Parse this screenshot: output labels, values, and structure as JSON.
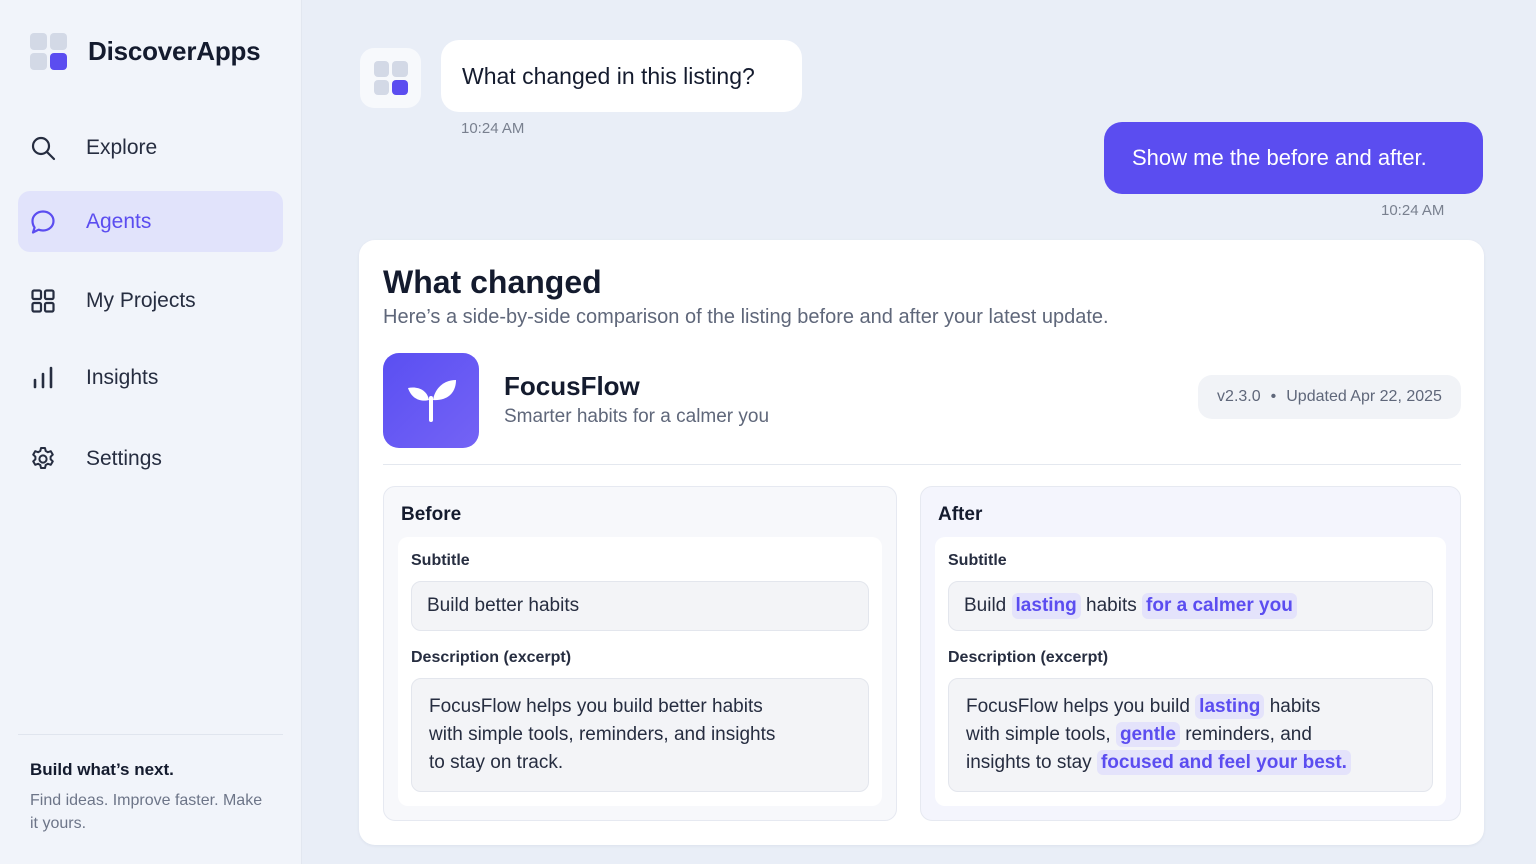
{
  "brand": {
    "name": "DiscoverApps"
  },
  "nav": {
    "items": [
      {
        "label": "Explore",
        "icon": "search-icon"
      },
      {
        "label": "Agents",
        "icon": "chat-bubble-icon",
        "active": true
      },
      {
        "label": "My Projects",
        "icon": "grid-icon"
      },
      {
        "label": "Insights",
        "icon": "bar-chart-icon"
      },
      {
        "label": "Settings",
        "icon": "gear-icon"
      }
    ]
  },
  "promo": {
    "title": "Build what’s next.",
    "text": "Find ideas. Improve faster. Make it yours."
  },
  "chat": {
    "question": "What changed in this listing?",
    "question_time": "10:24 AM",
    "reply": "Show me the before and after.",
    "reply_time": "10:24 AM"
  },
  "card": {
    "title": "What changed",
    "subtitle": "Here’s a side-by-side comparison of the listing before and after your latest update.",
    "app": {
      "name": "FocusFlow",
      "tagline": "Smarter habits for a calmer you",
      "version": "v2.3.0",
      "separator": "•",
      "updated": "Updated Apr 22, 2025",
      "icon": "sprout-icon"
    },
    "before": {
      "title": "Before",
      "subtitle_label": "Subtitle",
      "subtitle_value": "Build better habits",
      "description_label": "Description (excerpt)",
      "description_lines": [
        "FocusFlow helps you build better habits",
        "with simple tools, reminders, and insights",
        "to stay on track."
      ]
    },
    "after": {
      "title": "After",
      "subtitle_label": "Subtitle",
      "subtitle_parts": [
        "Build",
        "lasting",
        "habits",
        "for a calmer you"
      ],
      "description_label": "Description (excerpt)",
      "description_parts": {
        "l1a": "FocusFlow helps you build",
        "l1b": "lasting",
        "l1c": "habits",
        "l2a": "with simple tools,",
        "l2b": "gentle",
        "l2c": "reminders, and",
        "l3a": "insights to stay",
        "l3b": "focused and feel your best."
      }
    }
  },
  "colors": {
    "accent": "#5b4df0",
    "highlight_bg": "#e4e3fb",
    "app_bg": "#e9eef7"
  }
}
